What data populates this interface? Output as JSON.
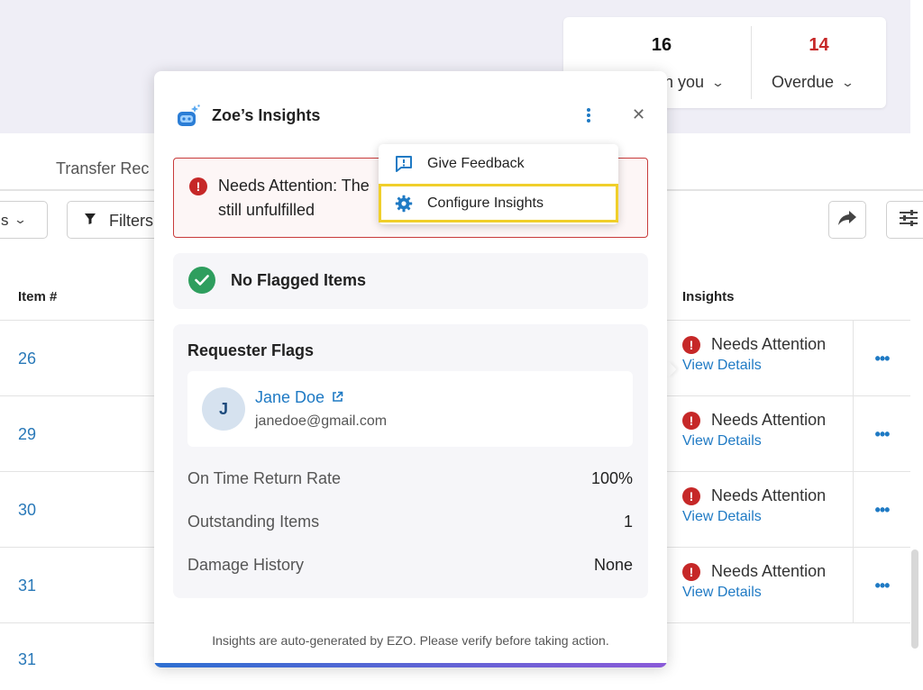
{
  "stats": {
    "assigned": {
      "count": "16",
      "label": "n you"
    },
    "overdue": {
      "count": "14",
      "label": "Overdue"
    }
  },
  "tabs": {
    "transfer": "Transfer Rec"
  },
  "toolbar": {
    "left_fragment": "s",
    "filters_label": "Filters"
  },
  "table": {
    "headers": {
      "item": "Item #",
      "insights": "Insights"
    },
    "rows": [
      {
        "item": "26",
        "status": "Needs Attention",
        "link": "View Details"
      },
      {
        "item": "29",
        "status": "Needs Attention",
        "link": "View Details"
      },
      {
        "item": "30",
        "status": "Needs Attention",
        "link": "View Details"
      },
      {
        "item": "31",
        "status": "Needs Attention",
        "link": "View Details"
      },
      {
        "item": "31",
        "status": "",
        "link": ""
      }
    ]
  },
  "panel": {
    "title": "Zoe’s Insights",
    "alert_text": "Needs Attention: The still unfulfilled",
    "flagged_label": "No Flagged Items",
    "requester": {
      "title": "Requester Flags",
      "avatar_initial": "J",
      "name": "Jane Doe",
      "email": "janedoe@gmail.com",
      "stats": [
        {
          "label": "On Time Return Rate",
          "value": "100%"
        },
        {
          "label": "Outstanding Items",
          "value": "1"
        },
        {
          "label": "Damage History",
          "value": "None"
        }
      ]
    },
    "disclaimer": "Insights are auto-generated by EZO. Please verify before taking action."
  },
  "menu": {
    "items": [
      {
        "label": "Give Feedback",
        "icon": "feedback-icon"
      },
      {
        "label": "Configure Insights",
        "icon": "gear-icon"
      }
    ]
  },
  "colors": {
    "accent": "#1f7ac4",
    "danger": "#c62828",
    "success": "#2e9e5e",
    "highlight": "#f0cf2a"
  }
}
